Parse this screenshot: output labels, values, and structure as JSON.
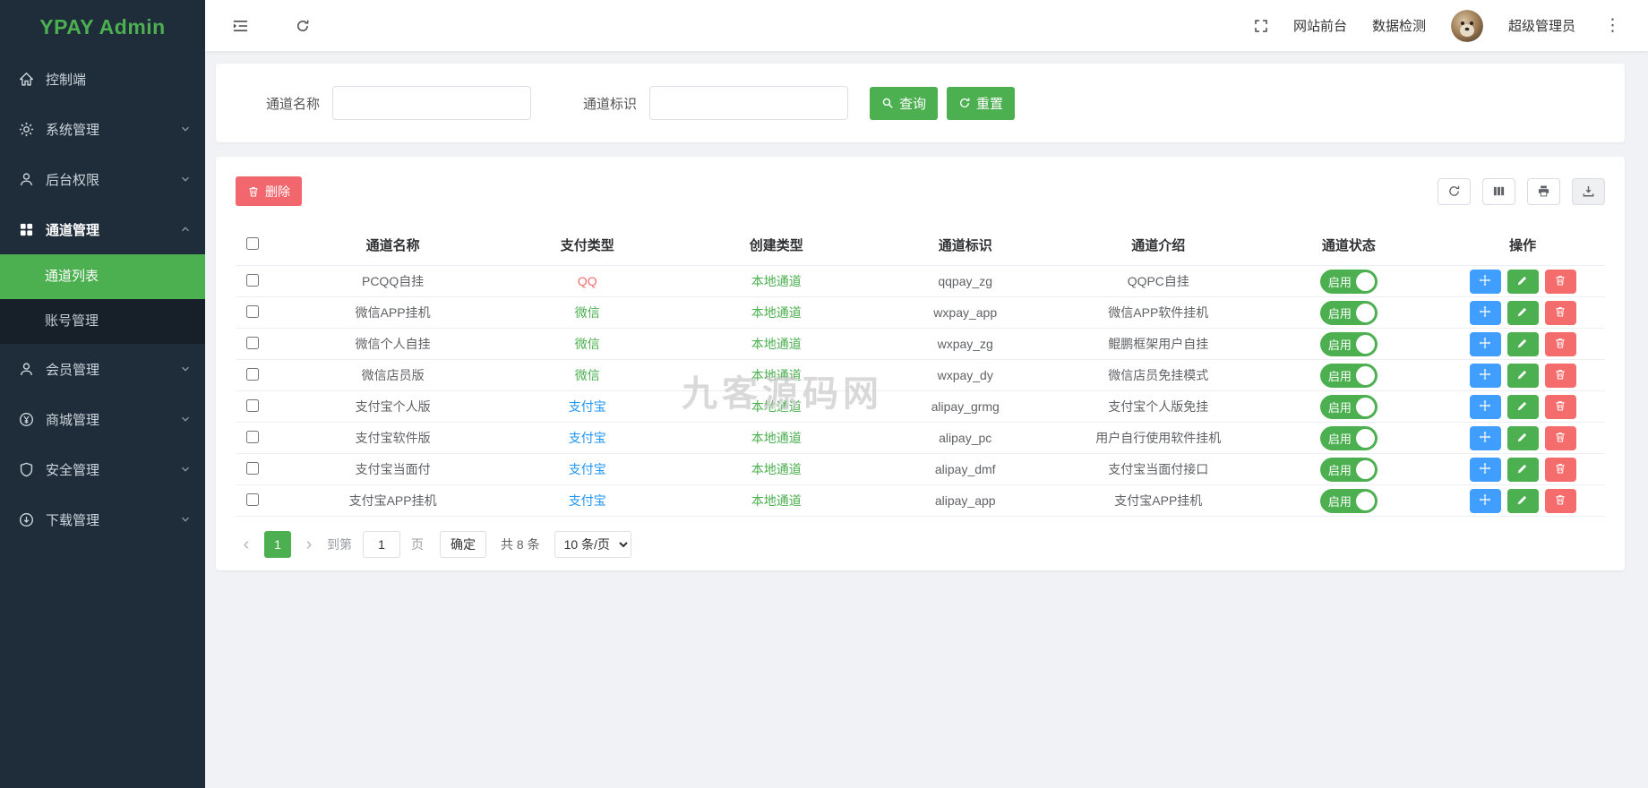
{
  "app": {
    "logo": "YPAY Admin"
  },
  "sidebar": {
    "items_top": [
      {
        "label": "控制端",
        "icon": "home",
        "chevron": false,
        "active": false
      },
      {
        "label": "系统管理",
        "icon": "gear",
        "chevron": true,
        "active": false
      },
      {
        "label": "后台权限",
        "icon": "user",
        "chevron": true,
        "active": false
      },
      {
        "label": "通道管理",
        "icon": "grid",
        "chevron": true,
        "active": true,
        "expanded": true
      }
    ],
    "submenu": [
      {
        "label": "通道列表",
        "active": true
      },
      {
        "label": "账号管理",
        "active": false
      }
    ],
    "items_bottom": [
      {
        "label": "会员管理",
        "icon": "user",
        "chevron": true,
        "active": false
      },
      {
        "label": "商城管理",
        "icon": "mall",
        "chevron": true,
        "active": false
      },
      {
        "label": "安全管理",
        "icon": "shield",
        "chevron": true,
        "active": false
      },
      {
        "label": "下载管理",
        "icon": "download",
        "chevron": true,
        "active": false
      }
    ]
  },
  "header": {
    "frontend": "网站前台",
    "datacheck": "数据检测",
    "username": "超级管理员"
  },
  "search": {
    "name_label": "通道名称",
    "code_label": "通道标识",
    "query_label": "查询",
    "reset_label": "重置"
  },
  "toolbar": {
    "delete_label": "删除"
  },
  "table": {
    "headers": [
      "通道名称",
      "支付类型",
      "创建类型",
      "通道标识",
      "通道介绍",
      "通道状态",
      "操作"
    ],
    "create_type_color": "#4caf50",
    "rows": [
      {
        "name": "PCQQ自挂",
        "pay_type": "QQ",
        "pay_type_color": "#f56c6c",
        "create_type": "本地通道",
        "code": "qqpay_zg",
        "intro": "QQPC自挂",
        "status": "启用"
      },
      {
        "name": "微信APP挂机",
        "pay_type": "微信",
        "pay_type_color": "#4caf50",
        "create_type": "本地通道",
        "code": "wxpay_app",
        "intro": "微信APP软件挂机",
        "status": "启用"
      },
      {
        "name": "微信个人自挂",
        "pay_type": "微信",
        "pay_type_color": "#4caf50",
        "create_type": "本地通道",
        "code": "wxpay_zg",
        "intro": "鲲鹏框架用户自挂",
        "status": "启用"
      },
      {
        "name": "微信店员版",
        "pay_type": "微信",
        "pay_type_color": "#4caf50",
        "create_type": "本地通道",
        "code": "wxpay_dy",
        "intro": "微信店员免挂模式",
        "status": "启用"
      },
      {
        "name": "支付宝个人版",
        "pay_type": "支付宝",
        "pay_type_color": "#2196f3",
        "create_type": "本地通道",
        "code": "alipay_grmg",
        "intro": "支付宝个人版免挂",
        "status": "启用"
      },
      {
        "name": "支付宝软件版",
        "pay_type": "支付宝",
        "pay_type_color": "#2196f3",
        "create_type": "本地通道",
        "code": "alipay_pc",
        "intro": "用户自行使用软件挂机",
        "status": "启用"
      },
      {
        "name": "支付宝当面付",
        "pay_type": "支付宝",
        "pay_type_color": "#2196f3",
        "create_type": "本地通道",
        "code": "alipay_dmf",
        "intro": "支付宝当面付接口",
        "status": "启用"
      },
      {
        "name": "支付宝APP挂机",
        "pay_type": "支付宝",
        "pay_type_color": "#2196f3",
        "create_type": "本地通道",
        "code": "alipay_app",
        "intro": "支付宝APP挂机",
        "status": "启用"
      }
    ]
  },
  "pagination": {
    "current_page": "1",
    "goto_prefix": "到第",
    "goto_input_value": "1",
    "goto_suffix": "页",
    "confirm_label": "确定",
    "total_label": "共 8 条",
    "per_page_label": "10 条/页"
  },
  "watermark": "九客源码网",
  "colors": {
    "accent_green": "#4caf50",
    "danger_red": "#f56c6c",
    "action_blue": "#409eff",
    "sidebar_bg": "#1f2d3a",
    "submenu_bg": "#171f29"
  }
}
